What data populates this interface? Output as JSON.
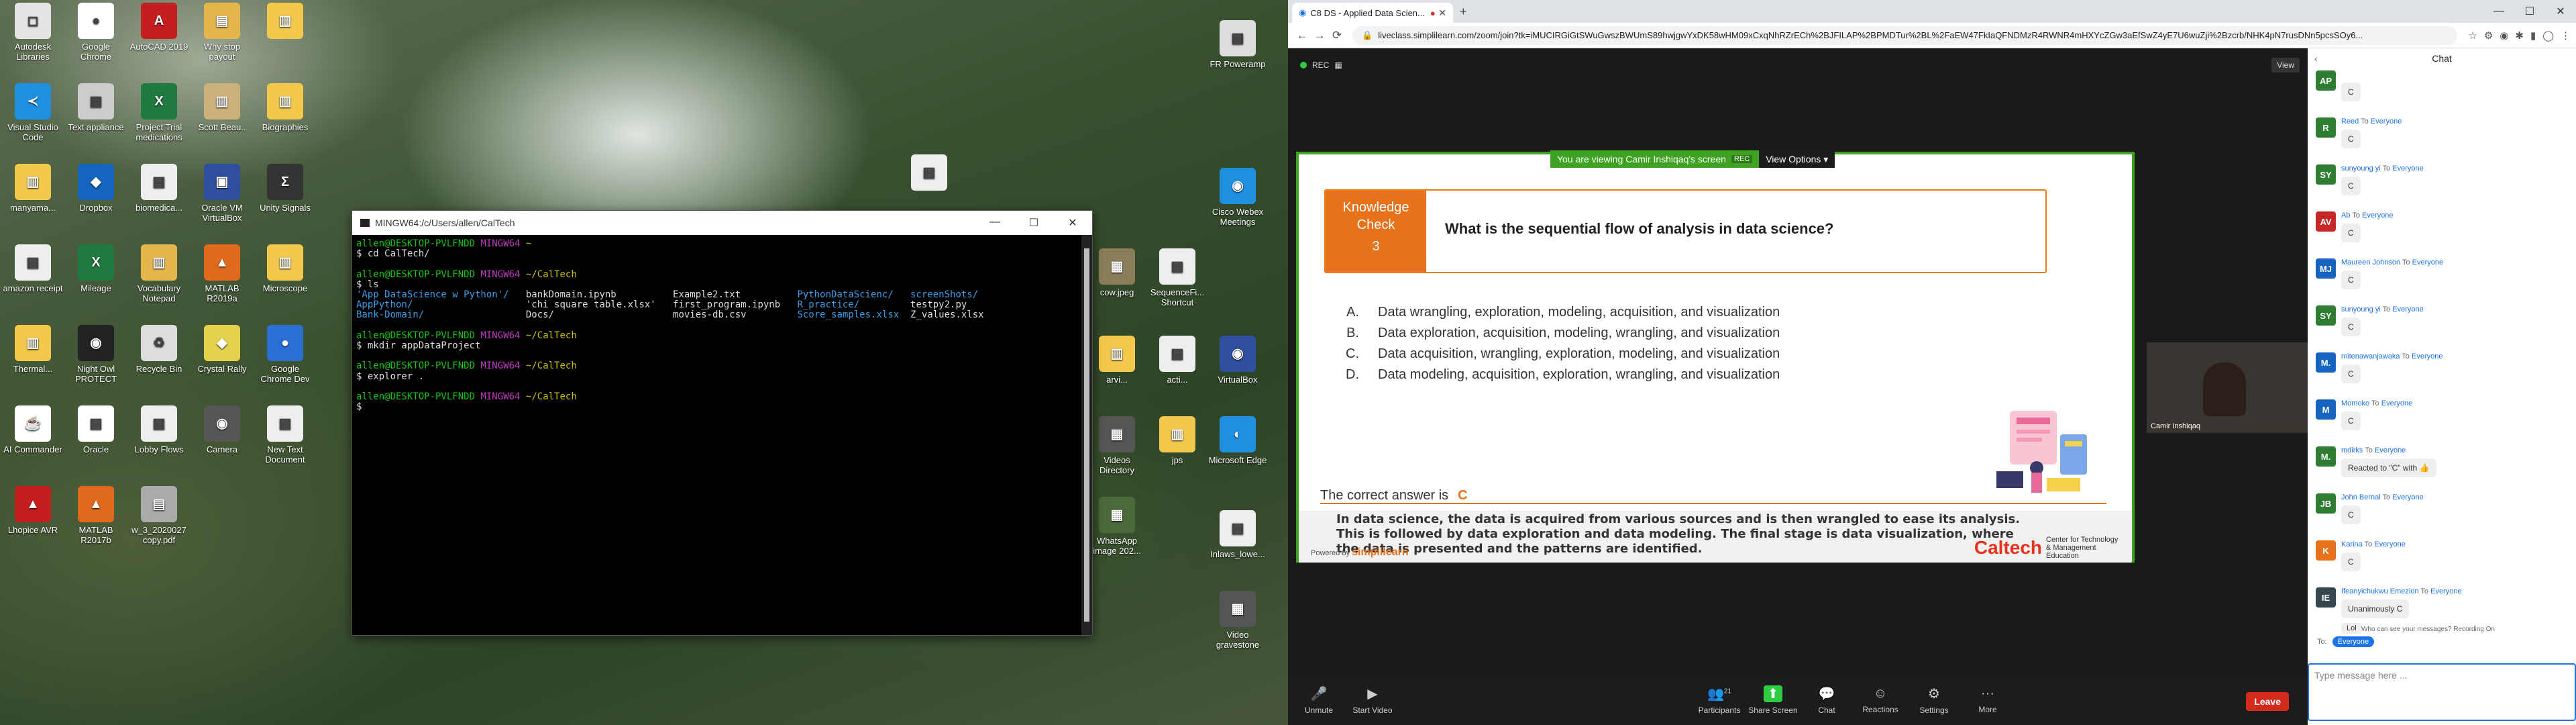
{
  "desktop": {
    "icons": [
      {
        "label": "Autodesk Libraries",
        "color": "#e4e4e4",
        "glyph": "◻"
      },
      {
        "label": "Google Chrome",
        "color": "#ffffff",
        "glyph": "●"
      },
      {
        "label": "AutoCAD 2019",
        "color": "#c41e1e",
        "glyph": "A"
      },
      {
        "label": "Why stop payout",
        "color": "#e5b64c",
        "glyph": "▤"
      },
      {
        "label": "",
        "color": "#f2c94c",
        "glyph": "▥"
      },
      {
        "label": "Visual Studio Code",
        "color": "#1f8fe0",
        "glyph": "≺"
      },
      {
        "label": "Text appliance",
        "color": "#cccccc",
        "glyph": "▤"
      },
      {
        "label": "Project Trial medications",
        "color": "#1f7a3f",
        "glyph": "X"
      },
      {
        "label": "Scott Beau..",
        "color": "#cdb17a",
        "glyph": "▥"
      },
      {
        "label": "Biographies",
        "color": "#f2c94c",
        "glyph": "▥"
      },
      {
        "label": "manyama...",
        "color": "#f2c94c",
        "glyph": "▥"
      },
      {
        "label": "Dropbox",
        "color": "#1565c0",
        "glyph": "◆"
      },
      {
        "label": "biomedica...",
        "color": "#eeeeee",
        "glyph": "▤"
      },
      {
        "label": "Oracle VM VirtualBox",
        "color": "#2f4fa0",
        "glyph": "▣"
      },
      {
        "label": "Unity Signals",
        "color": "#333333",
        "glyph": "Σ"
      },
      {
        "label": "amazon receipt",
        "color": "#eeeeee",
        "glyph": "▤"
      },
      {
        "label": "Mileage",
        "color": "#1f7a3f",
        "glyph": "X"
      },
      {
        "label": "Vocabulary Notepad",
        "color": "#e5b64c",
        "glyph": "▥"
      },
      {
        "label": "MATLAB R2019a",
        "color": "#e06a1b",
        "glyph": "▲"
      },
      {
        "label": "Microscope",
        "color": "#f2c94c",
        "glyph": "▥"
      },
      {
        "label": "Thermal...",
        "color": "#f2c94c",
        "glyph": "▥"
      },
      {
        "label": "Night Owl PROTECT",
        "color": "#222222",
        "glyph": "◉"
      },
      {
        "label": "Recycle Bin",
        "color": "#dddddd",
        "glyph": "♻"
      },
      {
        "label": "Crystal Rally",
        "color": "#e6d14c",
        "glyph": "◆"
      },
      {
        "label": "Google Chrome Dev",
        "color": "#2a6fd6",
        "glyph": "●"
      },
      {
        "label": "AI Commander",
        "color": "#ffffff",
        "glyph": "☕"
      },
      {
        "label": "Oracle",
        "color": "#ffffff",
        "glyph": "▤"
      },
      {
        "label": "Lobby Flows",
        "color": "#eeeeee",
        "glyph": "▤"
      },
      {
        "label": "Camera",
        "color": "#555555",
        "glyph": "◉"
      },
      {
        "label": "New Text Document",
        "color": "#eeeeee",
        "glyph": "▤"
      },
      {
        "label": "Lhopice AVR",
        "color": "#c41e1e",
        "glyph": "▲"
      },
      {
        "label": "MATLAB R2017b",
        "color": "#e06a1b",
        "glyph": "▲"
      },
      {
        "label": "w_3_2020027 copy.pdf",
        "color": "#aaaaaa",
        "glyph": "▤"
      }
    ],
    "right_icons": [
      {
        "label": "FR Poweramp",
        "color": "#dddddd",
        "glyph": "▤"
      },
      {
        "label": "",
        "color": "#eeeeee",
        "glyph": "▤"
      },
      {
        "label": "Cisco Webex Meetings",
        "color": "#1f8fe0",
        "glyph": "◉"
      },
      {
        "label": "cow.jpeg",
        "color": "#8a7d5a",
        "glyph": "▦"
      },
      {
        "label": "SequenceFi... Shortcut",
        "color": "#eeeeee",
        "glyph": "▤"
      },
      {
        "label": "arvi...",
        "color": "#f2c94c",
        "glyph": "▥"
      },
      {
        "label": "acti...",
        "color": "#eeeeee",
        "glyph": "▤"
      },
      {
        "label": "VirtualBox",
        "color": "#2f4fa0",
        "glyph": "◉"
      },
      {
        "label": "Videos Directory",
        "color": "#555555",
        "glyph": "▦"
      },
      {
        "label": "jps",
        "color": "#f2c94c",
        "glyph": "▥"
      },
      {
        "label": "Microsoft Edge",
        "color": "#1f8fe0",
        "glyph": "◐"
      },
      {
        "label": "WhatsApp image 202...",
        "color": "#4a6a3a",
        "glyph": "▦"
      },
      {
        "label": "Inlaws_lowe...",
        "color": "#eeeeee",
        "glyph": "▤"
      },
      {
        "label": "Video gravestone",
        "color": "#555555",
        "glyph": "▦"
      }
    ]
  },
  "terminal": {
    "title": "MINGW64:/c/Users/allen/CalTech",
    "controls": [
      "—",
      "☐",
      "✕"
    ],
    "user": "allen@DESKTOP-PVLFNDD",
    "env": "MINGW64",
    "cwd_home": "~",
    "cwd_caltech": "~/CalTech",
    "cmd1": "$ cd CalTech/",
    "cmd2": "$ ls",
    "ls_col1": [
      "'App DataScience w Python'/",
      "AppPython/",
      "Bank-Domain/"
    ],
    "ls_col2": [
      "bankDomain.ipynb",
      "'chi square table.xlsx'",
      "Docs/"
    ],
    "ls_col3": [
      "Example2.txt",
      "first_program.ipynb",
      "movies-db.csv"
    ],
    "ls_col4": [
      "PythonDataScienc/",
      "R_practice/",
      "Score_samples.xlsx"
    ],
    "ls_col5": [
      "screenShots/",
      "testpy2.py",
      "Z_values.xlsx"
    ],
    "cmd3": "$ mkdir appDataProject",
    "cmd4": "$ explorer .",
    "cmd5": "$"
  },
  "browser": {
    "tab_title": "C8 DS - Applied Data Scien...",
    "url": "liveclass.simplilearn.com/zoom/join?tk=iMUCIRGiGtSWuGwszBWUmS89hwjgwYxDK58wHM09xCxqNhRZrECh%2BJFILAP%2BPMDTur%2BL%2FaEW47FkIaQFNDMzR4RWNR4mHXYcZGw3aEfSwZ4yE7U6wuZji%2Bzcrb/NHK4pN7rusDNn5pcsSOy6...",
    "nav": [
      "←",
      "→",
      "⟳"
    ],
    "ext": [
      "☆",
      "⚙",
      "◉",
      "✱",
      "▮",
      "◯",
      "⋮"
    ],
    "winctl": [
      "—",
      "☐",
      "✕"
    ]
  },
  "zoom": {
    "rec": "REC",
    "view": "View",
    "viewing": "You are viewing Camir Inshiqaq's screen",
    "viewing_rec": "REC",
    "view_options": "View Options ▾",
    "kc_label1": "Knowledge",
    "kc_label2": "Check",
    "kc_num": "3",
    "question": "What is the sequential flow of analysis in data science?",
    "options": [
      {
        "letter": "A.",
        "text": "Data wrangling, exploration, modeling, acquisition, and visualization"
      },
      {
        "letter": "B.",
        "text": "Data exploration, acquisition, modeling, wrangling, and visualization"
      },
      {
        "letter": "C.",
        "text": "Data acquisition, wrangling, exploration, modeling, and visualization"
      },
      {
        "letter": "D.",
        "text": "Data modeling, acquisition, exploration, wrangling, and visualization"
      }
    ],
    "correct_label": "The correct answer is",
    "correct_value": "C",
    "explanation": "In data science, the data is acquired from various sources and is then wrangled to ease its analysis. This is followed by data exploration and data modeling. The final stage is data visualization, where the data is presented and the patterns are identified.",
    "powered_by": "Powered by",
    "brand": "simplilearn",
    "caltech": "Caltech",
    "caltech_sub": "Center for Technology & Management Education",
    "cam_name": "Camir Inshiqaq",
    "toolbar": [
      {
        "icon": "🎤",
        "label": "Unmute"
      },
      {
        "icon": "▶",
        "label": "Start Video"
      },
      {
        "icon": "👥",
        "label": "Participants"
      },
      {
        "icon": "⬆",
        "label": "Share Screen"
      },
      {
        "icon": "💬",
        "label": "Chat"
      },
      {
        "icon": "☺",
        "label": "Reactions"
      },
      {
        "icon": "⚙",
        "label": "Settings"
      },
      {
        "icon": "···",
        "label": "More"
      }
    ],
    "participants_count": "21",
    "leave": "Leave"
  },
  "chat": {
    "title": "Chat",
    "messages": [
      {
        "initials": "AP",
        "color": "#2e7d32",
        "from": "",
        "to": "",
        "text": "C"
      },
      {
        "initials": "R",
        "color": "#2e7d32",
        "from": "Reed",
        "to": "Everyone",
        "text": "C"
      },
      {
        "initials": "SY",
        "color": "#2e7d32",
        "from": "sunyoung yi",
        "to": "Everyone",
        "text": "C"
      },
      {
        "initials": "AV",
        "color": "#c62828",
        "from": "Ab",
        "to": "Everyone",
        "text": "C"
      },
      {
        "initials": "MJ",
        "color": "#1565c0",
        "from": "Maureen Johnson",
        "to": "Everyone",
        "text": "C"
      },
      {
        "initials": "SY",
        "color": "#2e7d32",
        "from": "sunyoung yi",
        "to": "Everyone",
        "text": "C"
      },
      {
        "initials": "M.",
        "color": "#1565c0",
        "from": "mitenawanjawaka",
        "to": "Everyone",
        "text": "C"
      },
      {
        "initials": "M",
        "color": "#1565c0",
        "from": "Momoko",
        "to": "Everyone",
        "text": "C"
      },
      {
        "initials": "M.",
        "color": "#2e7d32",
        "from": "mdirks",
        "to": "Everyone",
        "text": "Reacted to \"C\" with 👍"
      },
      {
        "initials": "JB",
        "color": "#2e7d32",
        "from": "John Bernal",
        "to": "Everyone",
        "text": "C"
      },
      {
        "initials": "K",
        "color": "#e8721b",
        "from": "Karina",
        "to": "Everyone",
        "text": "C"
      },
      {
        "initials": "IE",
        "color": "#37474f",
        "from": "Ifeanyichukwu Emezion",
        "to": "Everyone",
        "text": "Unanimously C"
      }
    ],
    "last": "Lol",
    "to_label": "To:",
    "to_value": "Everyone",
    "info": "Who can see your messages? Recording On",
    "placeholder": "Type message here ..."
  }
}
